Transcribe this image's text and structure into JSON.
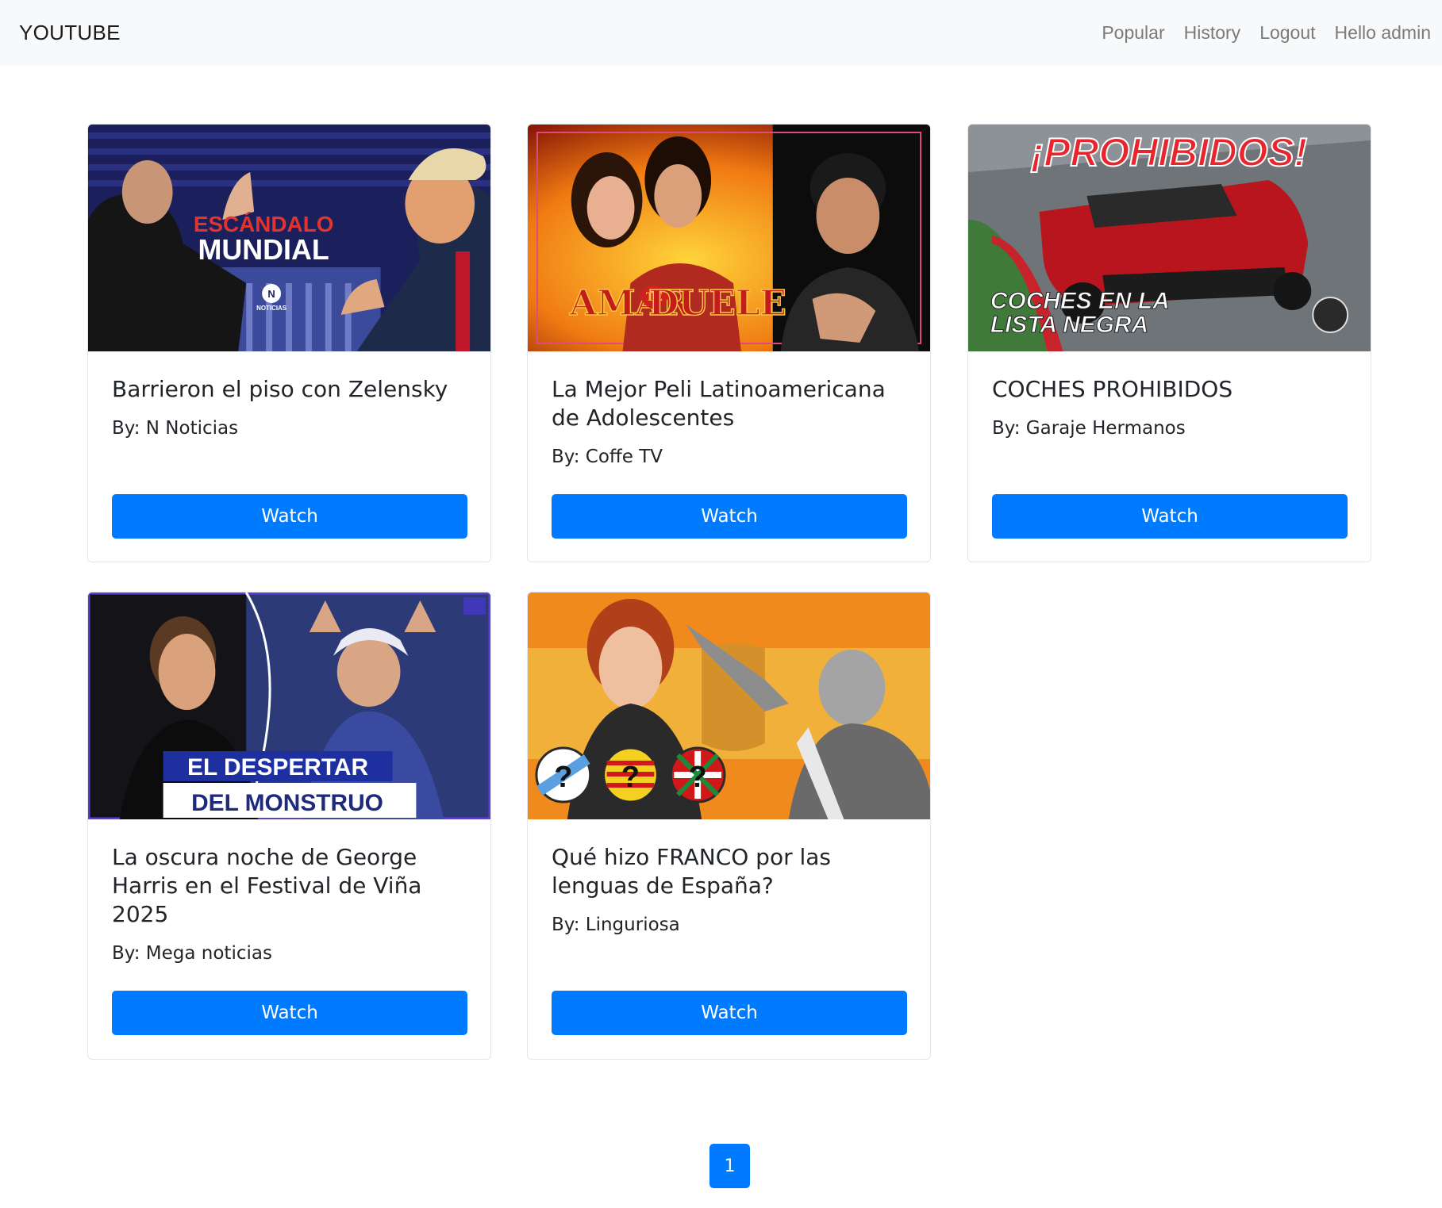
{
  "navbar": {
    "brand": "YOUTUBE",
    "links": [
      "Popular",
      "History",
      "Logout",
      "Hello admin"
    ]
  },
  "videos": [
    {
      "title": "Barrieron el piso con Zelensky",
      "author": "By: N Noticias",
      "watch_label": "Watch",
      "thumb_text": [
        "ESCÁNDALO",
        "MUNDIAL",
        "N",
        "NOTICIAS"
      ]
    },
    {
      "title": "La Mejor Peli Latinoamericana de Adolescentes",
      "author": "By: Coffe TV",
      "watch_label": "Watch",
      "thumb_text": [
        "AMAR",
        "TE",
        "DUELE"
      ]
    },
    {
      "title": "COCHES PROHIBIDOS",
      "author": "By: Garaje Hermanos",
      "watch_label": "Watch",
      "thumb_text": [
        "¡PROHIBIDOS!",
        "COCHES EN LA",
        "LISTA NEGRA"
      ]
    },
    {
      "title": "La oscura noche de George Harris en el Festival de Viña 2025",
      "author": "By: Mega noticias",
      "watch_label": "Watch",
      "thumb_text": [
        "EL DESPERTAR",
        "DEL MONSTRUO"
      ]
    },
    {
      "title": "Qué hizo FRANCO por las lenguas de España?",
      "author": "By: Linguriosa",
      "watch_label": "Watch",
      "thumb_text": [
        "?",
        "?",
        "?"
      ]
    }
  ],
  "pagination": {
    "current_page": "1"
  },
  "colors": {
    "primary": "#007bff",
    "navbar_bg": "#f8f9fa"
  }
}
